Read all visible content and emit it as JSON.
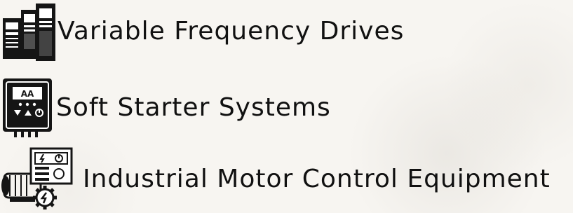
{
  "product_list": {
    "items": [
      {
        "label": "Variable Frequency Drives",
        "icon": "vfd-drives-icon"
      },
      {
        "label": "Soft Starter Systems",
        "icon": "soft-starter-icon"
      },
      {
        "label": "Industrial Motor Control Equipment",
        "icon": "motor-control-equipment-icon"
      }
    ]
  },
  "colors": {
    "text": "#111111",
    "icon": "#151515",
    "background": "#f7f5f1"
  }
}
